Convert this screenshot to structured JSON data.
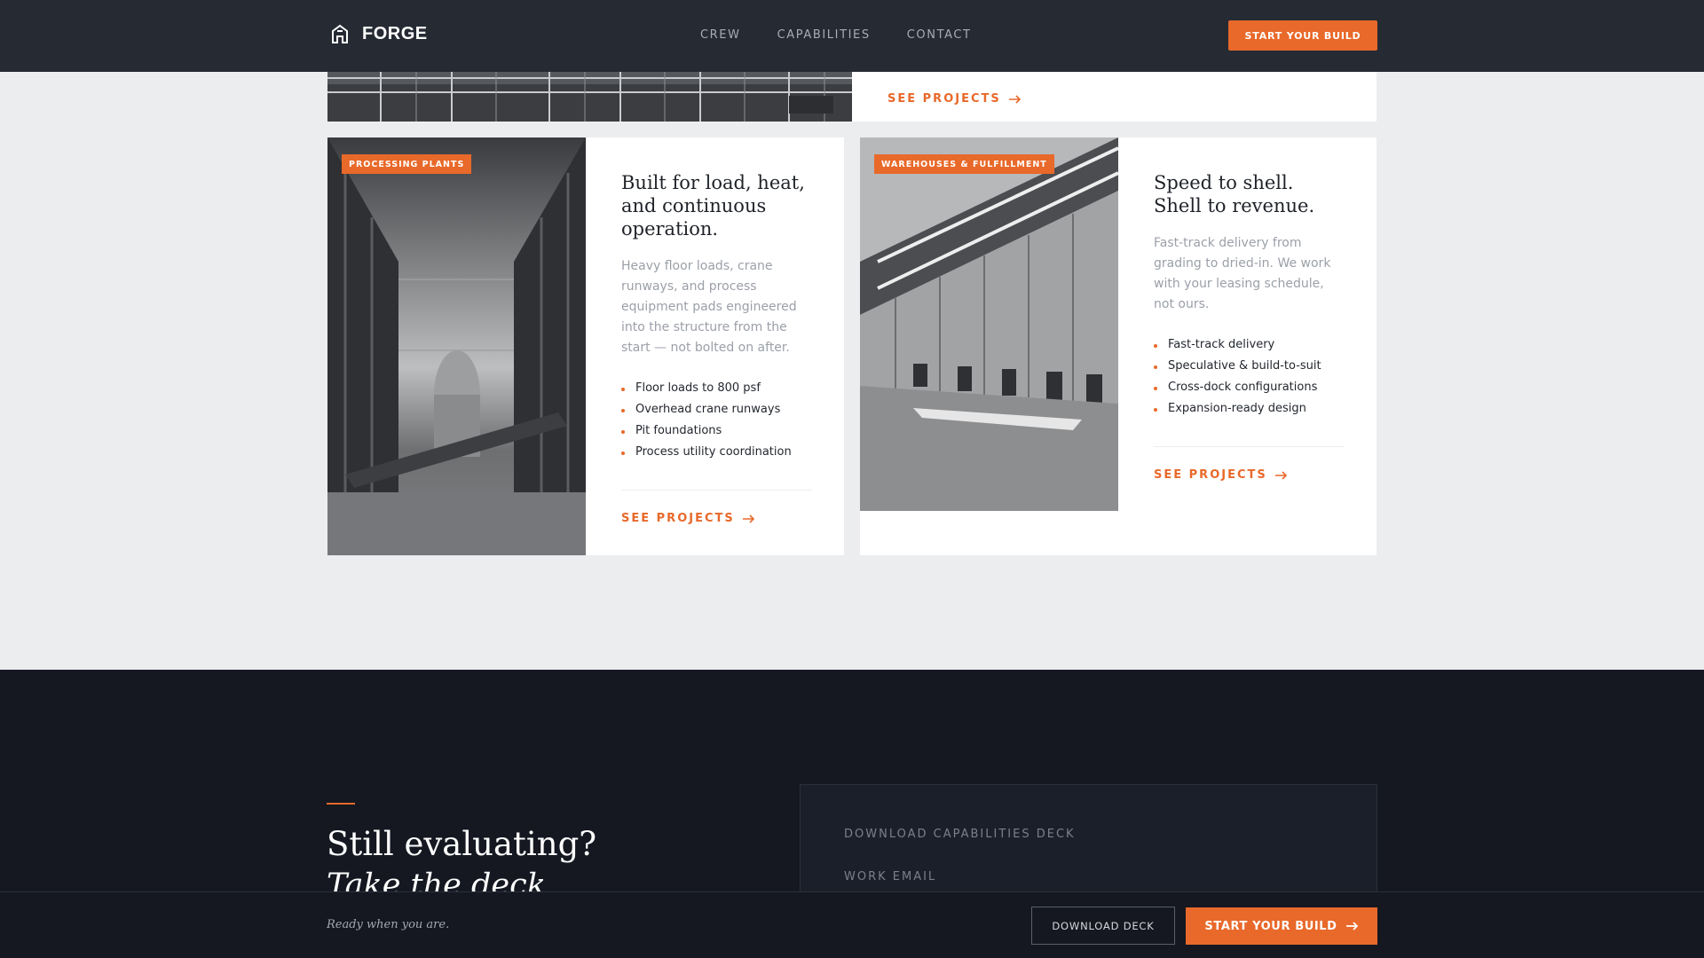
{
  "nav": {
    "brand": "FORGE",
    "links": [
      "CREW",
      "CAPABILITIES",
      "CONTACT"
    ],
    "cta": "START YOUR BUILD"
  },
  "top_card": {
    "see_projects": "SEE PROJECTS"
  },
  "cards": [
    {
      "badge": "PROCESSING PLANTS",
      "title": "Built for load, heat, and continuous operation.",
      "description": "Heavy floor loads, crane runways, and process equipment pads engineered into the structure from the start — not bolted on after.",
      "features": [
        "Floor loads to 800 psf",
        "Overhead crane runways",
        "Pit foundations",
        "Process utility coordination"
      ],
      "link": "SEE PROJECTS"
    },
    {
      "badge": "WAREHOUSES & FULFILLMENT",
      "title": "Speed to shell. Shell to revenue.",
      "description": "Fast-track delivery from grading to dried-in. We work with your leasing schedule, not ours.",
      "features": [
        "Fast-track delivery",
        "Speculative & build-to-suit",
        "Cross-dock configurations",
        "Expansion-ready design"
      ],
      "link": "SEE PROJECTS"
    }
  ],
  "cta_section": {
    "heading": "Still evaluating?",
    "heading_italic": "Take the deck.",
    "deck_label": "DOWNLOAD CAPABILITIES DECK",
    "email_label": "WORK EMAIL"
  },
  "sticky_bar": {
    "note": "Ready when you are.",
    "download": "DOWNLOAD DECK",
    "start": "START YOUR BUILD"
  },
  "colors": {
    "accent": "#E8692A",
    "nav_bg": "#252A33",
    "dark_bg": "#151821",
    "page_bg": "#ECEDEF"
  }
}
